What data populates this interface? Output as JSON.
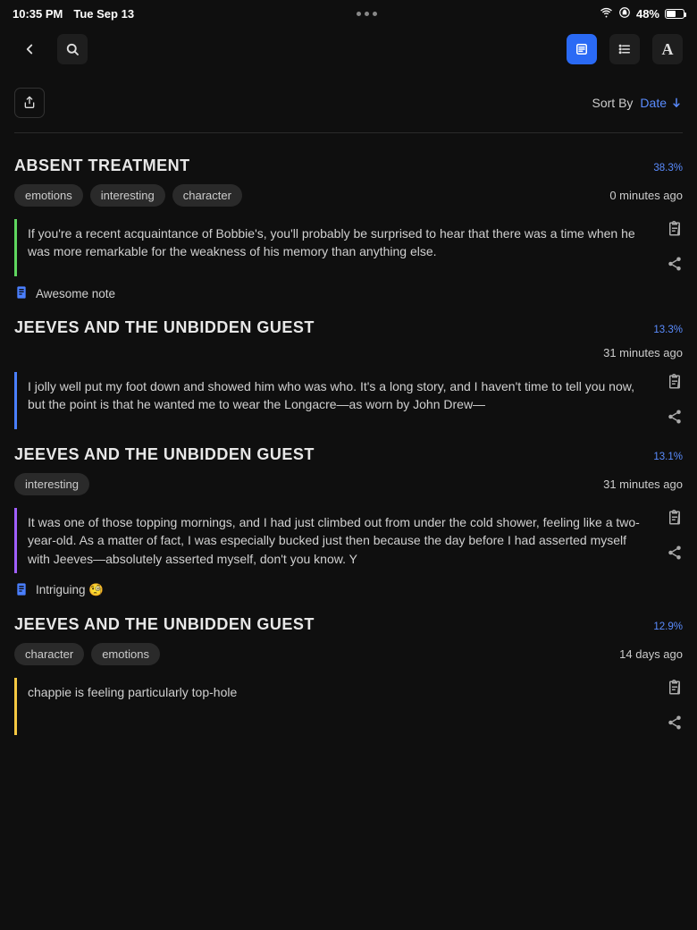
{
  "status": {
    "time": "10:35 PM",
    "date": "Tue Sep 13",
    "battery": "48%"
  },
  "sort": {
    "label": "Sort By",
    "value": "Date"
  },
  "entries": [
    {
      "title": "ABSENT TREATMENT",
      "pct": "38.3%",
      "tags": [
        "emotions",
        "interesting",
        "character"
      ],
      "time": "0 minutes ago",
      "color": "#5fd65f",
      "quote": "If you're a recent acquaintance of Bobbie's, you'll probably be surprised to hear that there was a time when he was more remarkable for the weakness of his memory than anything else.",
      "note": "Awesome note"
    },
    {
      "title": "JEEVES AND THE UNBIDDEN GUEST",
      "pct": "13.3%",
      "tags": [],
      "time": "31 minutes ago",
      "color": "#4a7fff",
      "quote": "I jolly well put my foot down and showed him who was who. It's a long story, and I haven't time to tell you now, but the point is that he wanted me to wear the Longacre—as worn by John Drew—",
      "note": null
    },
    {
      "title": "JEEVES AND THE UNBIDDEN GUEST",
      "pct": "13.1%",
      "tags": [
        "interesting"
      ],
      "time": "31 minutes ago",
      "color": "#a05fff",
      "quote": "It was one of those topping mornings, and I had just climbed out from under the cold shower, feeling like a two-year-old. As a matter of fact, I was especially bucked just then because the day before I had asserted myself with Jeeves—absolutely asserted myself, don't you know. Y",
      "note": "Intriguing 🧐"
    },
    {
      "title": "JEEVES AND THE UNBIDDEN GUEST",
      "pct": "12.9%",
      "tags": [
        "character",
        "emotions"
      ],
      "time": "14 days ago",
      "color": "#f5c842",
      "quote": "chappie is feeling particularly top-hole",
      "note": null
    }
  ]
}
